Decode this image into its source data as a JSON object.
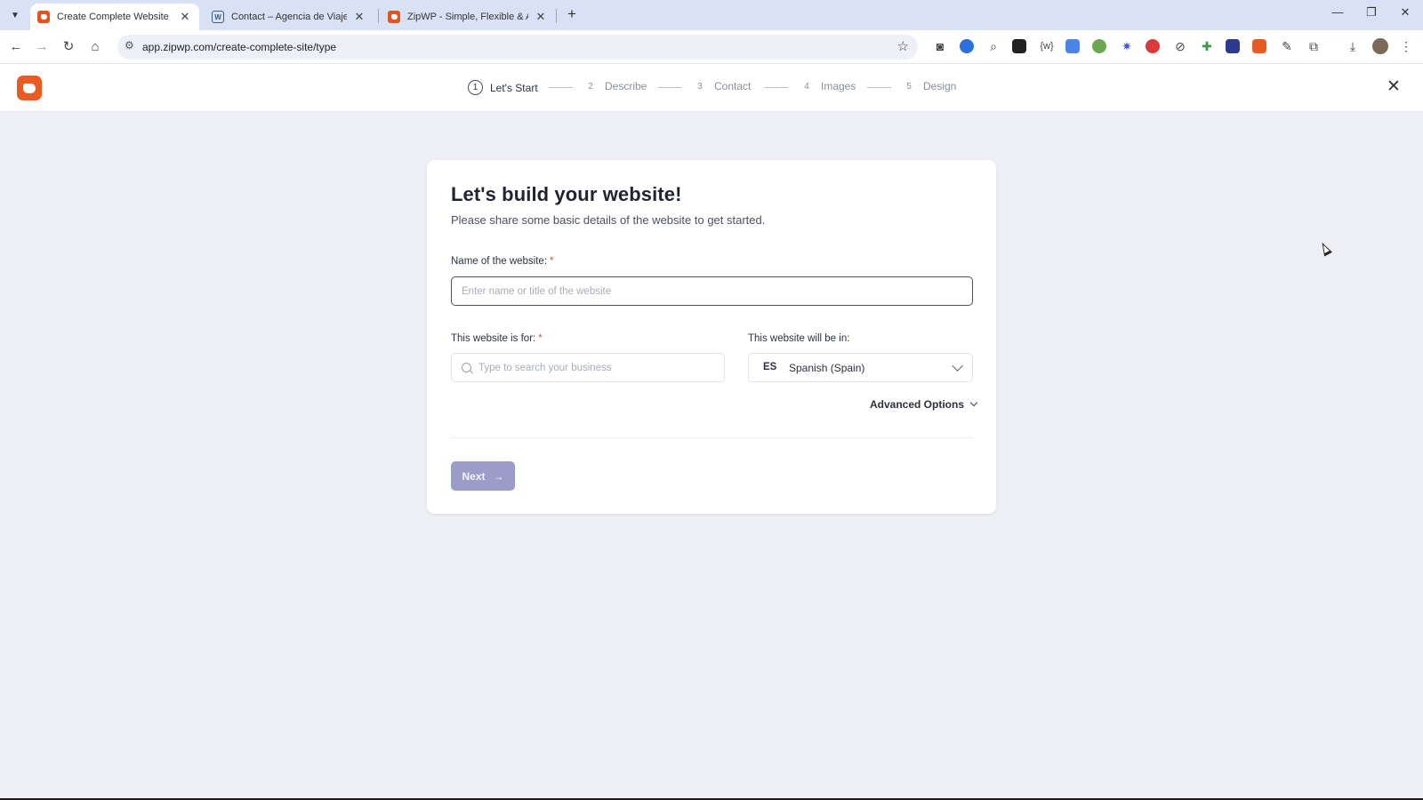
{
  "browser": {
    "tabs": [
      {
        "title": "Create Complete Website",
        "active": true,
        "favicon": "zipwp-icon"
      },
      {
        "title": "Contact – Agencia de Viajes de",
        "active": false,
        "favicon": "wordpress-icon"
      },
      {
        "title": "ZipWP - Simple, Flexible & Affo",
        "active": false,
        "favicon": "zipwp-icon"
      }
    ],
    "url": "app.zipwp.com/create-complete-site/type",
    "new_tab_glyph": "+",
    "close_glyph": "✕"
  },
  "steps": [
    {
      "num": "1",
      "label": "Let's Start",
      "active": true
    },
    {
      "num": "2",
      "label": "Describe",
      "active": false
    },
    {
      "num": "3",
      "label": "Contact",
      "active": false
    },
    {
      "num": "4",
      "label": "Images",
      "active": false
    },
    {
      "num": "5",
      "label": "Design",
      "active": false
    }
  ],
  "form": {
    "title": "Let's build your website!",
    "subtitle": "Please share some basic details of the website to get started.",
    "name_label": "Name of the website:",
    "required_mark": "*",
    "name_placeholder": "Enter name or title of the website",
    "business_label": "This website is for:",
    "business_placeholder": "Type to search your business",
    "language_label": "This website will be in:",
    "language_code": "ES",
    "language_name": "Spanish (Spain)",
    "advanced_options": "Advanced Options",
    "next_label": "Next",
    "next_arrow": "→"
  },
  "colors": {
    "brand": "#ea5b22",
    "next_button": "#9b9dc8",
    "required": "#e24b4b"
  }
}
